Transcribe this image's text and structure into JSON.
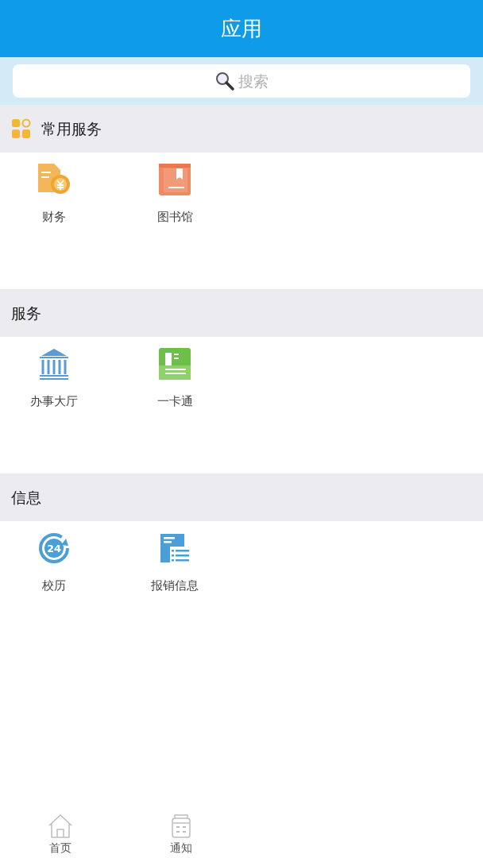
{
  "header": {
    "title": "应用"
  },
  "search": {
    "placeholder": "搜索"
  },
  "sections": [
    {
      "title": "常用服务",
      "kind": "featured",
      "items": [
        {
          "label": "财务"
        },
        {
          "label": "图书馆"
        }
      ]
    },
    {
      "title": "服务",
      "kind": "plain",
      "items": [
        {
          "label": "办事大厅"
        },
        {
          "label": "一卡通"
        }
      ]
    },
    {
      "title": "信息",
      "kind": "plain",
      "items": [
        {
          "label": "校历",
          "icon_text": "24"
        },
        {
          "label": "报销信息"
        }
      ]
    }
  ],
  "tab_bar": [
    {
      "label": "首页",
      "selected": false
    },
    {
      "label": "通知",
      "selected": false
    }
  ]
}
